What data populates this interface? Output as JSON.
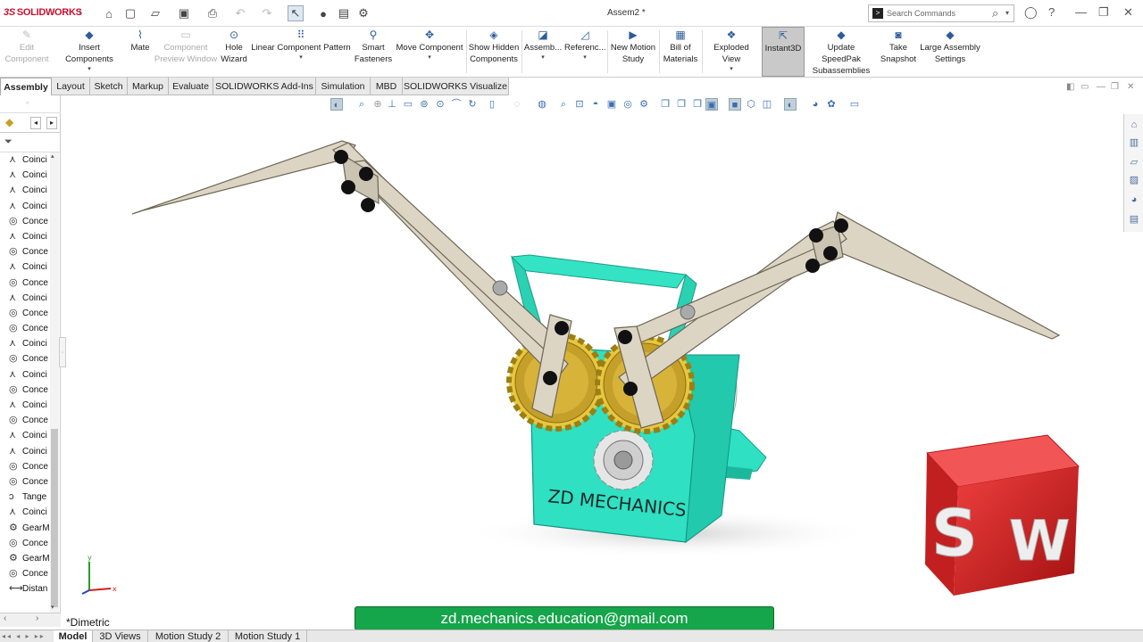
{
  "app": {
    "brand": "SOLIDWORKS",
    "window_title": "Assem2 *"
  },
  "search": {
    "placeholder": "Search Commands"
  },
  "ribbon": {
    "edit_component": [
      "Edit",
      "Component"
    ],
    "insert_components": [
      "Insert Components"
    ],
    "mate": [
      "Mate"
    ],
    "component_preview": [
      "Component",
      "Preview Window"
    ],
    "hole_wizard": [
      "Hole",
      "Wizard"
    ],
    "linear_pattern": [
      "Linear Component Pattern"
    ],
    "smart_fasteners": [
      "Smart",
      "Fasteners"
    ],
    "move_component": [
      "Move Component"
    ],
    "show_hidden": [
      "Show Hidden",
      "Components"
    ],
    "assembly_features": [
      "Assemb..."
    ],
    "reference_geometry": [
      "Referenc..."
    ],
    "new_motion_study": [
      "New Motion",
      "Study"
    ],
    "bill_of_materials": [
      "Bill of",
      "Materials"
    ],
    "exploded_view": [
      "Exploded View"
    ],
    "instant3d": [
      "Instant3D"
    ],
    "update_speedpak": [
      "Update SpeedPak",
      "Subassemblies"
    ],
    "take_snapshot": [
      "Take",
      "Snapshot"
    ],
    "large_assembly": [
      "Large Assembly",
      "Settings"
    ]
  },
  "tabs": [
    "Assembly",
    "Layout",
    "Sketch",
    "Markup",
    "Evaluate",
    "SOLIDWORKS Add-Ins",
    "Simulation",
    "MBD",
    "SOLIDWORKS Visualize"
  ],
  "tree": [
    {
      "icon": "coincident-icon",
      "label": "Coinci"
    },
    {
      "icon": "coincident-icon",
      "label": "Coinci"
    },
    {
      "icon": "coincident-icon",
      "label": "Coinci"
    },
    {
      "icon": "coincident-icon",
      "label": "Coinci"
    },
    {
      "icon": "concentric-icon",
      "label": "Conce"
    },
    {
      "icon": "coincident-icon",
      "label": "Coinci"
    },
    {
      "icon": "concentric-icon",
      "label": "Conce"
    },
    {
      "icon": "coincident-icon",
      "label": "Coinci"
    },
    {
      "icon": "concentric-icon",
      "label": "Conce"
    },
    {
      "icon": "coincident-icon",
      "label": "Coinci"
    },
    {
      "icon": "concentric-icon",
      "label": "Conce"
    },
    {
      "icon": "concentric-icon",
      "label": "Conce"
    },
    {
      "icon": "coincident-icon",
      "label": "Coinci"
    },
    {
      "icon": "concentric-icon",
      "label": "Conce"
    },
    {
      "icon": "coincident-icon",
      "label": "Coinci"
    },
    {
      "icon": "concentric-icon",
      "label": "Conce"
    },
    {
      "icon": "coincident-icon",
      "label": "Coinci"
    },
    {
      "icon": "concentric-icon",
      "label": "Conce"
    },
    {
      "icon": "coincident-icon",
      "label": "Coinci"
    },
    {
      "icon": "coincident-icon",
      "label": "Coinci"
    },
    {
      "icon": "concentric-icon",
      "label": "Conce"
    },
    {
      "icon": "concentric-icon",
      "label": "Conce"
    },
    {
      "icon": "tangent-icon",
      "label": "Tange"
    },
    {
      "icon": "coincident-icon",
      "label": "Coinci"
    },
    {
      "icon": "gear-mate-icon",
      "label": "GearM"
    },
    {
      "icon": "concentric-icon",
      "label": "Conce"
    },
    {
      "icon": "gear-mate-icon",
      "label": "GearM"
    },
    {
      "icon": "concentric-icon",
      "label": "Conce"
    },
    {
      "icon": "distance-icon",
      "label": "Distan"
    }
  ],
  "viewport": {
    "view_orientation": "*Dimetric",
    "model_text": "ZD MECHANICS",
    "logo_letters": [
      "S",
      "W"
    ],
    "triad_x": "x",
    "triad_y": "y"
  },
  "footer_banner": "zd.mechanics.education@gmail.com",
  "bottom_tabs": [
    "Model",
    "3D Views",
    "Motion Study 2",
    "Motion Study 1"
  ],
  "colors": {
    "brand_red": "#c8102e",
    "base_teal": "#2fe0c2",
    "gear_gold": "#e8c640",
    "link_beige": "#ddd5c4",
    "banner_green": "#15a54a"
  }
}
